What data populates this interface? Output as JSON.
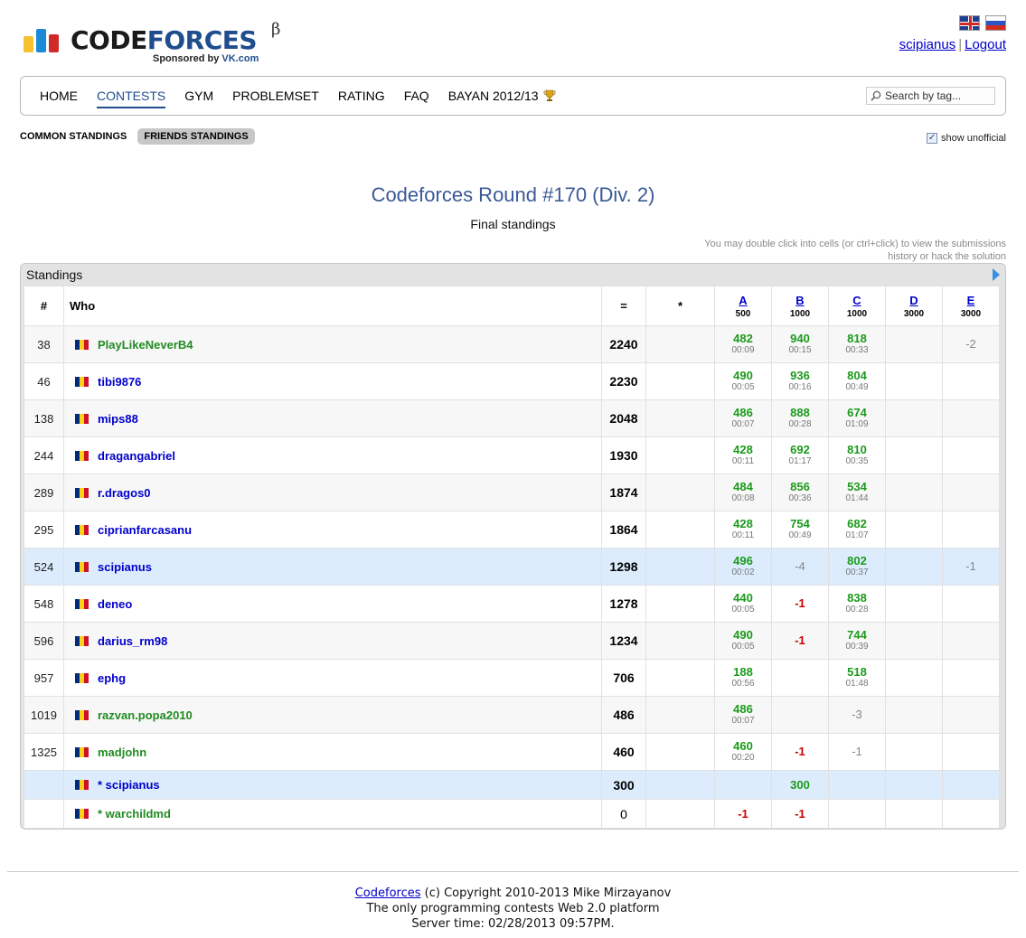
{
  "brand": {
    "word_code": "CODE",
    "word_forces": "FORCES",
    "beta": "β",
    "sponsor_prefix": "Sponsored by ",
    "sponsor_name": "VK.com"
  },
  "user": {
    "name": "scipianus",
    "separator": "|",
    "logout": "Logout"
  },
  "menu": {
    "items": [
      "HOME",
      "CONTESTS",
      "GYM",
      "PROBLEMSET",
      "RATING",
      "FAQ",
      "BAYAN 2012/13"
    ],
    "active": "CONTESTS",
    "search_placeholder": "Search by tag..."
  },
  "subtabs": [
    "COMMON STANDINGS",
    "FRIENDS STANDINGS"
  ],
  "show_unofficial": {
    "label": "show unofficial",
    "checked": true,
    "mark": "✓"
  },
  "contest": {
    "title": "Codeforces Round #170 (Div. 2)",
    "subtitle": "Final standings",
    "hint": "You may double click into cells (or ctrl+click) to view the submissions history or hack the solution"
  },
  "standings": {
    "caption": "Standings",
    "headers": {
      "rank": "#",
      "who": "Who",
      "points": "=",
      "penalty": "*"
    },
    "problems": [
      {
        "letter": "A",
        "cost": "500"
      },
      {
        "letter": "B",
        "cost": "1000"
      },
      {
        "letter": "C",
        "cost": "1000"
      },
      {
        "letter": "D",
        "cost": "3000"
      },
      {
        "letter": "E",
        "cost": "3000"
      }
    ],
    "rows": [
      {
        "rank": "38",
        "name": "PlayLikeNeverB4",
        "color": "green",
        "points": "2240",
        "penalty": "",
        "style": "alt",
        "cells": [
          [
            "482",
            "00:09"
          ],
          [
            "940",
            "00:15"
          ],
          [
            "818",
            "00:33"
          ],
          null,
          [
            "-2"
          ]
        ]
      },
      {
        "rank": "46",
        "name": "tibi9876",
        "color": "blue",
        "points": "2230",
        "penalty": "",
        "style": "",
        "cells": [
          [
            "490",
            "00:05"
          ],
          [
            "936",
            "00:16"
          ],
          [
            "804",
            "00:49"
          ],
          null,
          null
        ]
      },
      {
        "rank": "138",
        "name": "mips88",
        "color": "blue",
        "points": "2048",
        "penalty": "",
        "style": "alt",
        "cells": [
          [
            "486",
            "00:07"
          ],
          [
            "888",
            "00:28"
          ],
          [
            "674",
            "01:09"
          ],
          null,
          null
        ]
      },
      {
        "rank": "244",
        "name": "dragangabriel",
        "color": "blue",
        "points": "1930",
        "penalty": "",
        "style": "",
        "cells": [
          [
            "428",
            "00:11"
          ],
          [
            "692",
            "01:17"
          ],
          [
            "810",
            "00:35"
          ],
          null,
          null
        ]
      },
      {
        "rank": "289",
        "name": "r.dragos0",
        "color": "blue",
        "points": "1874",
        "penalty": "",
        "style": "alt",
        "cells": [
          [
            "484",
            "00:08"
          ],
          [
            "856",
            "00:36"
          ],
          [
            "534",
            "01:44"
          ],
          null,
          null
        ]
      },
      {
        "rank": "295",
        "name": "ciprianfarcasanu",
        "color": "blue",
        "points": "1864",
        "penalty": "",
        "style": "",
        "cells": [
          [
            "428",
            "00:11"
          ],
          [
            "754",
            "00:49"
          ],
          [
            "682",
            "01:07"
          ],
          null,
          null
        ]
      },
      {
        "rank": "524",
        "name": "scipianus",
        "color": "blue",
        "points": "1298",
        "penalty": "",
        "style": "hl",
        "cells": [
          [
            "496",
            "00:02"
          ],
          [
            "-4"
          ],
          [
            "802",
            "00:37"
          ],
          null,
          [
            "-1"
          ]
        ]
      },
      {
        "rank": "548",
        "name": "deneo",
        "color": "blue",
        "points": "1278",
        "penalty": "",
        "style": "",
        "cells": [
          [
            "440",
            "00:05"
          ],
          [
            "-1r"
          ],
          [
            "838",
            "00:28"
          ],
          null,
          null
        ]
      },
      {
        "rank": "596",
        "name": "darius_rm98",
        "color": "blue",
        "points": "1234",
        "penalty": "",
        "style": "alt",
        "cells": [
          [
            "490",
            "00:05"
          ],
          [
            "-1r"
          ],
          [
            "744",
            "00:39"
          ],
          null,
          null
        ]
      },
      {
        "rank": "957",
        "name": "ephg",
        "color": "blue",
        "points": "706",
        "penalty": "",
        "style": "",
        "cells": [
          [
            "188",
            "00:56"
          ],
          null,
          [
            "518",
            "01:48"
          ],
          null,
          null
        ]
      },
      {
        "rank": "1019",
        "name": "razvan.popa2010",
        "color": "green",
        "points": "486",
        "penalty": "",
        "style": "alt",
        "cells": [
          [
            "486",
            "00:07"
          ],
          null,
          [
            "-3"
          ],
          null,
          null
        ]
      },
      {
        "rank": "1325",
        "name": "madjohn",
        "color": "green",
        "points": "460",
        "penalty": "",
        "style": "",
        "cells": [
          [
            "460",
            "00:20"
          ],
          [
            "-1r"
          ],
          [
            "-1"
          ],
          null,
          null
        ]
      },
      {
        "rank": "",
        "name": "* scipianus",
        "color": "blue",
        "points": "300",
        "penalty": "",
        "style": "hl short",
        "cells": [
          null,
          [
            "300"
          ],
          null,
          null,
          null
        ]
      },
      {
        "rank": "",
        "name": "* warchildmd",
        "color": "green",
        "points": "0",
        "penalty": "",
        "style": "short plain",
        "cells": [
          [
            "-1r"
          ],
          [
            "-1r"
          ],
          null,
          null,
          null
        ]
      }
    ]
  },
  "footer": {
    "link": "Codeforces",
    "copyright": " (c) Copyright 2010-2013 Mike Mirzayanov",
    "line2": "The only programming contests Web 2.0 platform",
    "line3": "Server time: 02/28/2013 09:57PM."
  },
  "icons": {
    "logo": "codeforces-bars",
    "trophy": "trophy-icon",
    "search": "magnifier-icon"
  },
  "colors": {
    "brand_blue": "#1f4d8d",
    "title_blue": "#3b5998",
    "accepted": "#1b9a1b",
    "rejected": "#cc0000",
    "highlight_row": "#dcecfc"
  }
}
